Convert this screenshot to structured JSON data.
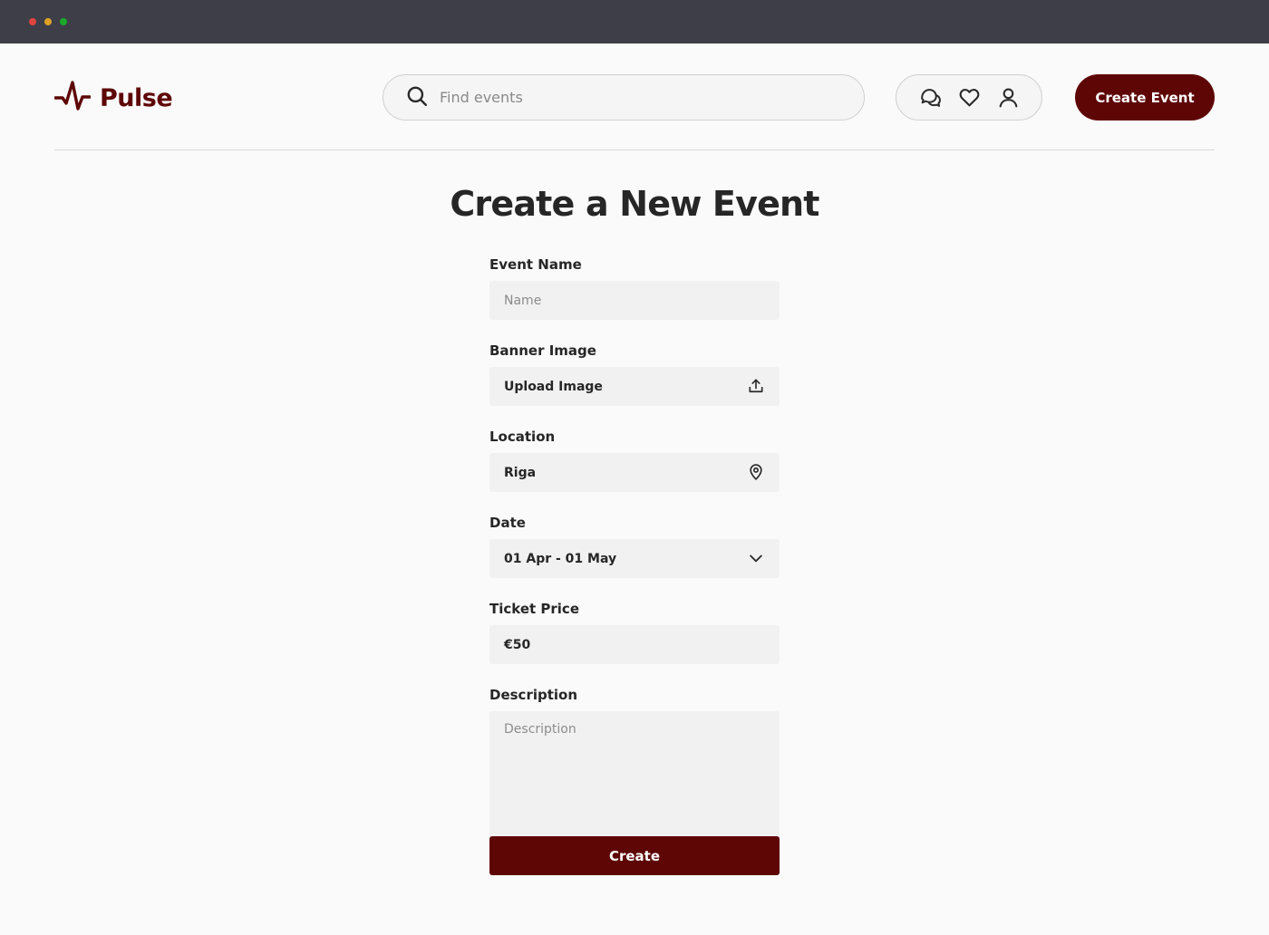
{
  "window": {
    "controls": [
      "close",
      "minimize",
      "maximize"
    ]
  },
  "header": {
    "logo_text": "Pulse",
    "logo_icon": "pulse-icon",
    "search_placeholder": "Find events",
    "icons": [
      "chat-icon",
      "heart-icon",
      "user-icon"
    ],
    "create_event_label": "Create Event"
  },
  "form": {
    "title": "Create a New Event",
    "event_name": {
      "label": "Event Name",
      "placeholder": "Name",
      "value": ""
    },
    "banner_image": {
      "label": "Banner Image",
      "value": "Upload Image",
      "icon": "upload-icon"
    },
    "location": {
      "label": "Location",
      "value": "Riga",
      "icon": "map-pin-icon"
    },
    "date": {
      "label": "Date",
      "value": "01 Apr - 01 May",
      "icon": "chevron-down-icon"
    },
    "ticket_price": {
      "label": "Ticket Price",
      "value": "€50"
    },
    "description": {
      "label": "Description",
      "placeholder": "Description",
      "value": ""
    },
    "submit_label": "Create"
  },
  "colors": {
    "brand": "#5e0606",
    "titlebar": "#3e3e48",
    "background": "#fafafa",
    "field_bg": "#f1f1f1"
  }
}
